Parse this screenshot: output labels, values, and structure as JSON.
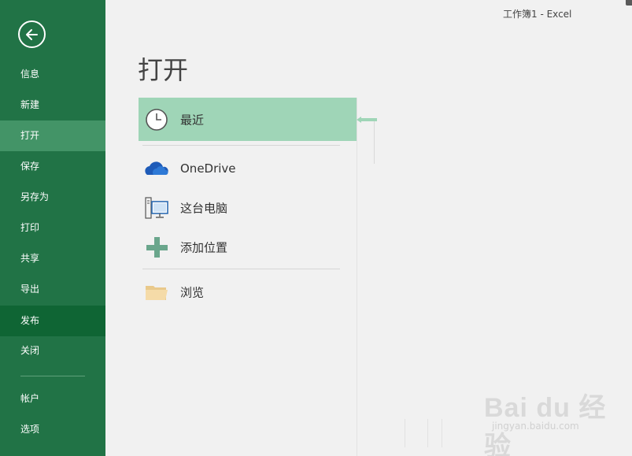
{
  "window": {
    "title": "工作簿1 - Excel"
  },
  "sidebar": {
    "items": [
      {
        "label": "信息"
      },
      {
        "label": "新建"
      },
      {
        "label": "打开"
      },
      {
        "label": "保存"
      },
      {
        "label": "另存为"
      },
      {
        "label": "打印"
      },
      {
        "label": "共享"
      },
      {
        "label": "导出"
      },
      {
        "label": "发布"
      },
      {
        "label": "关闭"
      },
      {
        "label": "帐户"
      },
      {
        "label": "选项"
      }
    ],
    "active": "打开",
    "hovered": "发布"
  },
  "main": {
    "title": "打开",
    "locations": [
      {
        "label": "最近",
        "icon": "clock-icon",
        "selected": true
      },
      {
        "label": "OneDrive",
        "icon": "cloud-icon"
      },
      {
        "label": "这台电脑",
        "icon": "computer-icon"
      },
      {
        "label": "添加位置",
        "icon": "plus-icon"
      },
      {
        "label": "浏览",
        "icon": "folder-icon"
      }
    ]
  },
  "watermark": {
    "text": "Bai du 经验",
    "sub": "jingyan.baidu.com"
  },
  "colors": {
    "sidebar": "#217346",
    "active": "#439467",
    "hover": "#0f6534",
    "selected": "#9fd5b7",
    "background": "#f1f1f1"
  }
}
